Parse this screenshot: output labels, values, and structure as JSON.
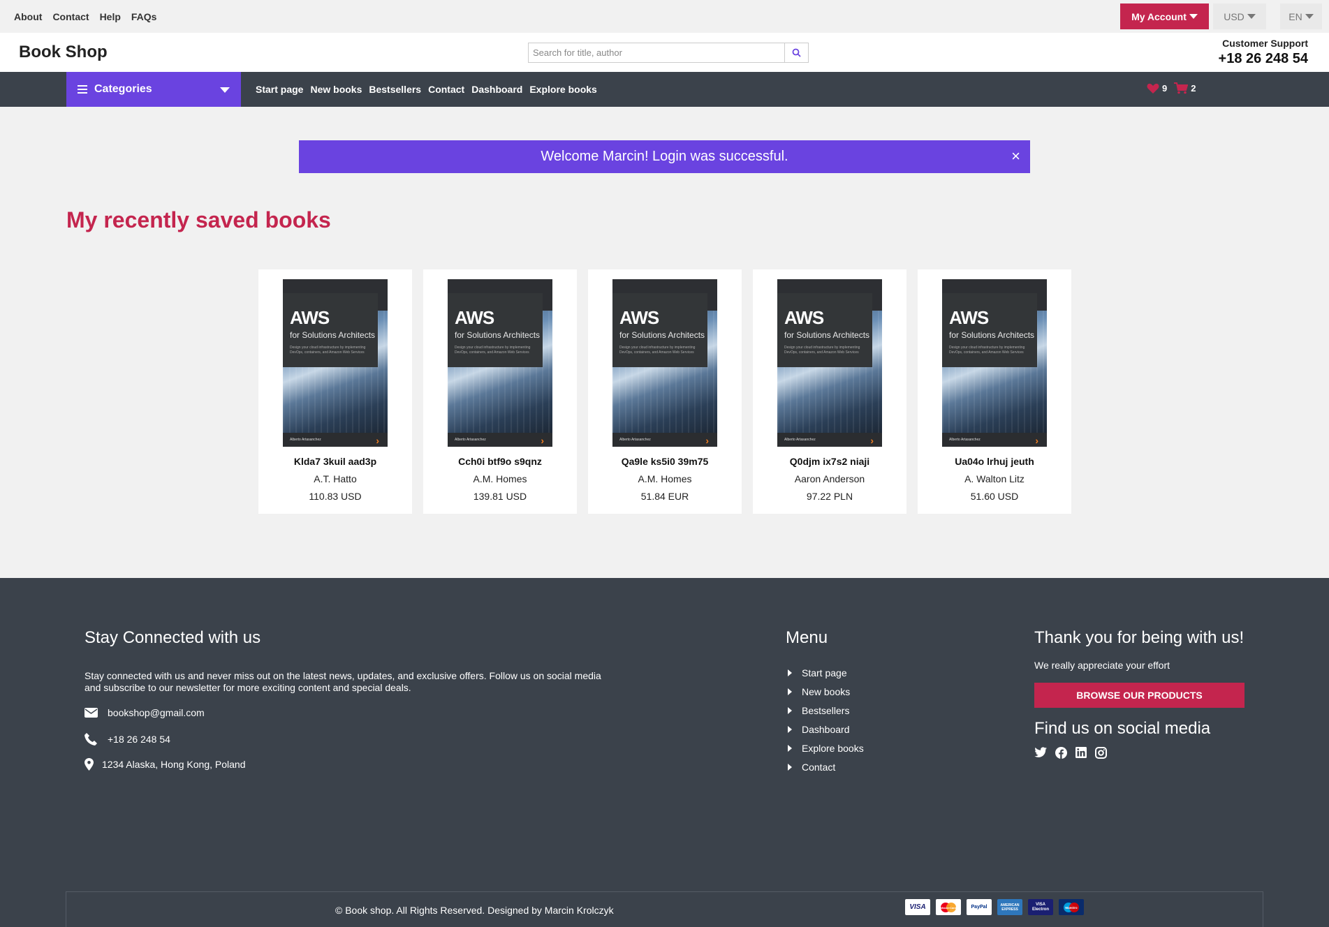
{
  "topbar": {
    "links": [
      "About",
      "Contact",
      "Help",
      "FAQs"
    ],
    "account_label": "My Account",
    "currency": "USD",
    "language": "EN"
  },
  "header": {
    "logo": "Book Shop",
    "search_placeholder": "Search for title, author",
    "support_label": "Customer Support",
    "support_phone": "+18 26 248 54"
  },
  "nav": {
    "categories_label": "Categories",
    "links": [
      "Start page",
      "New books",
      "Bestsellers",
      "Contact",
      "Dashboard",
      "Explore books"
    ],
    "wishlist_count": "9",
    "cart_count": "2"
  },
  "alert": {
    "message": "Welcome Marcin! Login was successful.",
    "close": "×"
  },
  "main": {
    "section_title": "My recently saved books",
    "books": [
      {
        "title": "Klda7 3kuil aad3p",
        "author": "A.T. Hatto",
        "price": "110.83 USD"
      },
      {
        "title": "Cch0i btf9o s9qnz",
        "author": "A.M. Homes",
        "price": "139.81 USD"
      },
      {
        "title": "Qa9le ks5i0 39m75",
        "author": "A.M. Homes",
        "price": "51.84 EUR"
      },
      {
        "title": "Q0djm ix7s2 niaji",
        "author": "Aaron Anderson",
        "price": "97.22 PLN"
      },
      {
        "title": "Ua04o lrhuj jeuth",
        "author": "A. Walton Litz",
        "price": "51.60 USD"
      }
    ],
    "cover": {
      "title": "AWS",
      "subtitle": "for Solutions Architects",
      "blurb": "Design your cloud infrastructure by implementing DevOps, containers, and Amazon Web Services",
      "author": "Alberto Artasanchez",
      "mark": "›"
    }
  },
  "footer": {
    "stay_title": "Stay Connected with us",
    "stay_text": "Stay connected with us and never miss out on the latest news, updates, and exclusive offers. Follow us on social media and subscribe to our newsletter for more exciting content and special deals.",
    "email": "bookshop@gmail.com",
    "phone": "+18 26 248 54",
    "address": "1234 Alaska, Hong Kong, Poland",
    "menu_title": "Menu",
    "menu_items": [
      "Start page",
      "New books",
      "Bestsellers",
      "Dashboard",
      "Explore books",
      "Contact"
    ],
    "thanks_title": "Thank you for being with us!",
    "thanks_text": "We really appreciate your effort",
    "browse_label": "BROWSE OUR PRODUCTS",
    "social_title": "Find us on social media",
    "social_icons": [
      "twitter-icon",
      "facebook-icon",
      "linkedin-icon",
      "instagram-icon"
    ],
    "copyright": "© Book shop. All Rights Reserved. Designed by Marcin Krolczyk",
    "payment_labels": [
      "VISA",
      "MasterCard",
      "PayPal",
      "AMERICAN EXPRESS",
      "VISA Electron",
      "Maestro"
    ]
  },
  "colors": {
    "accent": "#c4254e",
    "purple": "#6a43e0",
    "dark": "#3b424b"
  }
}
